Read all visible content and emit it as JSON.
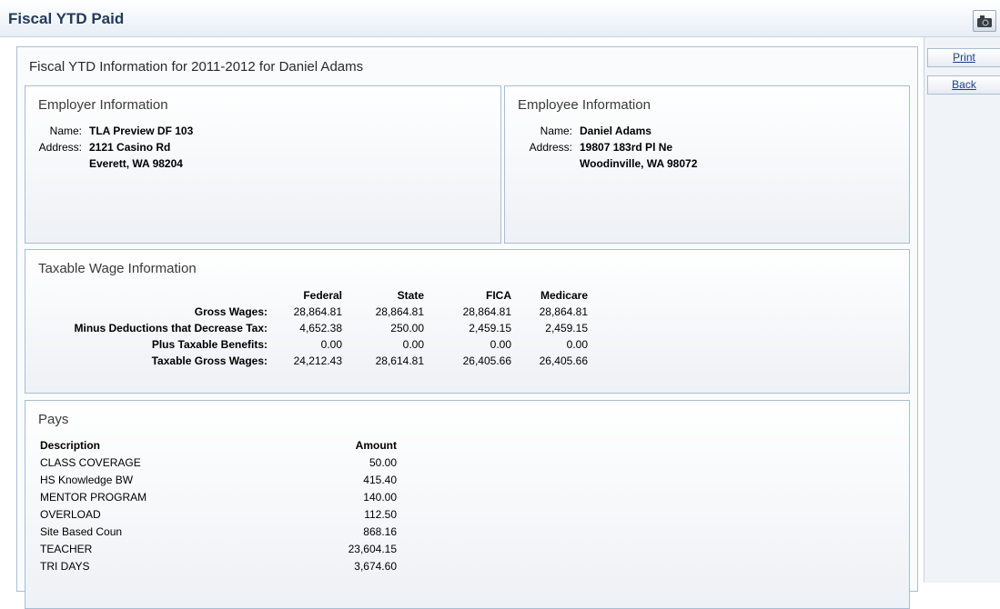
{
  "header": {
    "title": "Fiscal YTD Paid",
    "camera_icon": "camera-icon"
  },
  "sidebar": {
    "print_label": "Print",
    "back_label": "Back"
  },
  "main": {
    "heading": "Fiscal YTD Information for 2011-2012 for Daniel Adams"
  },
  "employer": {
    "title": "Employer Information",
    "name_label": "Name:",
    "name": "TLA Preview DF 103",
    "address_label": "Address:",
    "address_line1": "2121 Casino Rd",
    "address_line2": "Everett, WA 98204"
  },
  "employee": {
    "title": "Employee Information",
    "name_label": "Name:",
    "name": "Daniel Adams",
    "address_label": "Address:",
    "address_line1": "19807 183rd Pl Ne",
    "address_line2": "Woodinville, WA 98072"
  },
  "taxable": {
    "title": "Taxable Wage Information",
    "columns": [
      "Federal",
      "State",
      "FICA",
      "Medicare"
    ],
    "rows": [
      {
        "label": "Gross Wages:",
        "values": [
          "28,864.81",
          "28,864.81",
          "28,864.81",
          "28,864.81"
        ]
      },
      {
        "label": "Minus Deductions that Decrease Tax:",
        "values": [
          "4,652.38",
          "250.00",
          "2,459.15",
          "2,459.15"
        ]
      },
      {
        "label": "Plus Taxable Benefits:",
        "values": [
          "0.00",
          "0.00",
          "0.00",
          "0.00"
        ]
      },
      {
        "label": "Taxable Gross Wages:",
        "values": [
          "24,212.43",
          "28,614.81",
          "26,405.66",
          "26,405.66"
        ]
      }
    ]
  },
  "pays": {
    "title": "Pays",
    "col_description": "Description",
    "col_amount": "Amount",
    "rows": [
      {
        "description": "CLASS COVERAGE",
        "amount": "50.00"
      },
      {
        "description": "HS Knowledge BW",
        "amount": "415.40"
      },
      {
        "description": "MENTOR PROGRAM",
        "amount": "140.00"
      },
      {
        "description": "OVERLOAD",
        "amount": "112.50"
      },
      {
        "description": "Site Based Coun",
        "amount": "868.16"
      },
      {
        "description": "TEACHER",
        "amount": "23,604.15"
      },
      {
        "description": "TRI DAYS",
        "amount": "3,674.60"
      }
    ]
  }
}
